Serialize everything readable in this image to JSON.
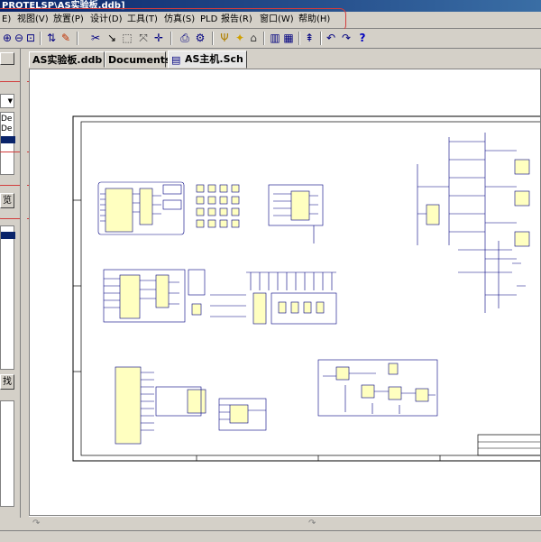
{
  "window": {
    "title": "PROTELSP\\AS实验板.ddb]"
  },
  "menu": [
    {
      "label": "E)"
    },
    {
      "label": "视图(V)"
    },
    {
      "label": "放置(P)"
    },
    {
      "label": "设计(D)"
    },
    {
      "label": "工具(T)"
    },
    {
      "label": "仿真(S)"
    },
    {
      "label": "PLD"
    },
    {
      "label": "报告(R)"
    },
    {
      "label": "窗口(W)"
    },
    {
      "label": "帮助(H)"
    }
  ],
  "toolbar": {
    "icons": [
      "zoom-in-icon",
      "zoom-out-icon",
      "zoom-fit-icon",
      "arrows-icon",
      "pencil-icon",
      "cut-icon",
      "select-area-icon",
      "move-icon",
      "cross-icon",
      "rotate-icon",
      "print-icon",
      "settings-icon",
      "probe-icon",
      "lamp-icon",
      "library-icon",
      "tool-icon",
      "align-icon",
      "undo-icon",
      "redo-icon",
      "help-icon"
    ]
  },
  "left_panel": {
    "list_items": [
      "De",
      "De"
    ],
    "button1_label": "览",
    "button2_label": "找"
  },
  "tabs": [
    {
      "label": "AS实验板.ddb"
    },
    {
      "label": "Documents"
    },
    {
      "label": "AS主机.Sch"
    }
  ],
  "colors": {
    "titlebar": "#0a246a",
    "annotation": "#d23c3c",
    "schematic": "#000080",
    "component": "#ffffc0"
  }
}
